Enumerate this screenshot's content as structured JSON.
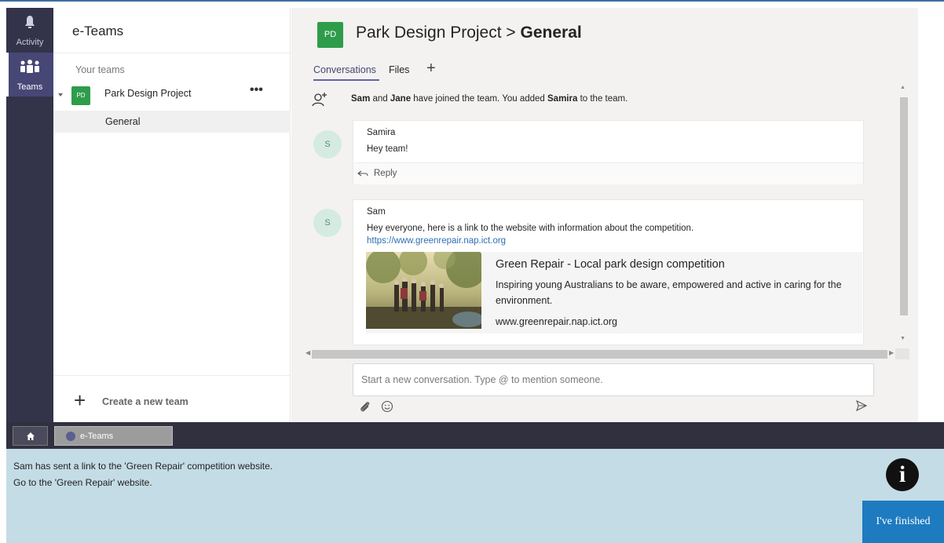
{
  "rail": {
    "activity_label": "Activity",
    "teams_label": "Teams"
  },
  "sidebar": {
    "title": "e-Teams",
    "your_teams_label": "Your teams",
    "team": {
      "avatar": "PD",
      "name": "Park Design Project",
      "more": "•••"
    },
    "channel": "General",
    "create_team_label": "Create a new team"
  },
  "header": {
    "avatar": "PD",
    "title_prefix": "Park Design Project > ",
    "title_channel": "General"
  },
  "tabs": {
    "conversations": "Conversations",
    "files": "Files",
    "add": "+"
  },
  "system_message": {
    "name1": "Sam",
    "and": " and ",
    "name2": "Jane",
    "mid": " have joined the team. You added ",
    "name3": "Samira",
    "end": " to the team."
  },
  "messages": [
    {
      "avatar": "S",
      "author": "Samira",
      "text": "Hey team!",
      "reply_label": "Reply"
    },
    {
      "avatar": "S",
      "author": "Sam",
      "text": "Hey everyone, here is a link to the website with information about the competition.",
      "link": "https://www.greenrepair.nap.ict.org",
      "preview": {
        "title": "Green Repair - Local park design competition",
        "description": "Inspiring young Australians to be aware, empowered and active in caring for the environment.",
        "url": "www.greenrepair.nap.ict.org"
      }
    }
  ],
  "compose": {
    "placeholder": "Start a new conversation. Type @ to mention someone."
  },
  "taskbar": {
    "app_label": "e-Teams"
  },
  "instructions": {
    "line1": "Sam has sent a link to the 'Green Repair' competition website.",
    "line2": "Go to the 'Green Repair' website."
  },
  "finish_button": "I've finished",
  "colors": {
    "rail": "#33344a",
    "team_avatar": "#2f9c4b",
    "accent": "#6264a7",
    "link": "#2f6fb3",
    "instruction_panel": "#c4dce5",
    "finish_button": "#1e7bc0"
  }
}
